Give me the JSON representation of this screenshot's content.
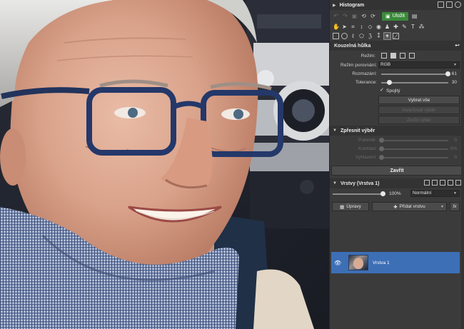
{
  "histogram": {
    "title": "Histogram"
  },
  "toolbar": {
    "save_label": "Uložit"
  },
  "magic_wand": {
    "title": "Kouzelná hůlka",
    "mode_label": "Režim:",
    "compare_mode_label": "Režim porovnání:",
    "compare_mode_value": "RGB",
    "blur_label": "Rozmazání:",
    "blur_value": "61",
    "blur_fraction": 0.99,
    "tolerance_label": "Tolerance:",
    "tolerance_value": "30",
    "tolerance_fraction": 0.12,
    "contiguous_label": "Spojitý",
    "select_all": "Vybrat vše",
    "invert_selection": "Invertovat výběr",
    "deselect": "Zrušit výběr"
  },
  "refine": {
    "title": "Zpřesnit výběr",
    "radius_label": "Poloměr:",
    "radius_value": "0",
    "contrast_label": "Kontrast:",
    "contrast_value": "0%",
    "smooth_label": "Vyhlazení:",
    "smooth_value": "0"
  },
  "close_label": "Zavřít",
  "layers": {
    "title": "Vrstvy (Vrstva 1)",
    "opacity_value": "100%",
    "opacity_fraction": 1.0,
    "blend_mode": "Normální",
    "edits_label": "Úpravy",
    "add_layer_label": "Přidat vrstvu",
    "fx_label": "fx",
    "items": [
      {
        "name": "Vrstva 1"
      }
    ]
  },
  "colors": {
    "accent": "#3d6fb6",
    "save": "#3a8a3a",
    "panel": "#3b3b3b"
  }
}
